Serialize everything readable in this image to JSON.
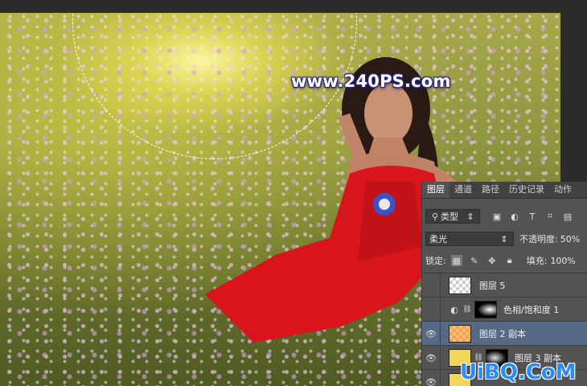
{
  "watermark": {
    "text": "www.240PS.com"
  },
  "corner_watermark": {
    "text": "UiBQ.CoM"
  },
  "panel": {
    "tabs": [
      "图层",
      "通道",
      "路径",
      "历史记录",
      "动作"
    ],
    "filter": {
      "label": "类型",
      "icons": [
        "image-filter-icon",
        "adjustment-filter-icon",
        "type-filter-icon",
        "shape-filter-icon",
        "smart-object-filter-icon"
      ]
    },
    "blend_mode": "柔光",
    "opacity_label": "不透明度:",
    "opacity_value": "50%",
    "lock_label": "锁定:",
    "fill_label": "填充:",
    "fill_value": "100%",
    "layers": [
      {
        "name": "图层 5",
        "visible": false,
        "selected": false,
        "thumb": "checker"
      },
      {
        "name": "色相/饱和度 1",
        "visible": false,
        "selected": false,
        "thumb": "adjustment"
      },
      {
        "name": "图层 2 副本",
        "visible": true,
        "selected": true,
        "thumb": "orange-checker"
      },
      {
        "name": "图层 3 副本",
        "visible": true,
        "selected": false,
        "thumb": "yellow"
      },
      {
        "name": "",
        "visible": true,
        "selected": false,
        "thumb": "yellow"
      }
    ]
  },
  "colors": {
    "selected_layer": "#566a85",
    "panel_bg": "#535353",
    "watermark_stroke": "#2b2a7a",
    "dress": "#d8141c"
  }
}
